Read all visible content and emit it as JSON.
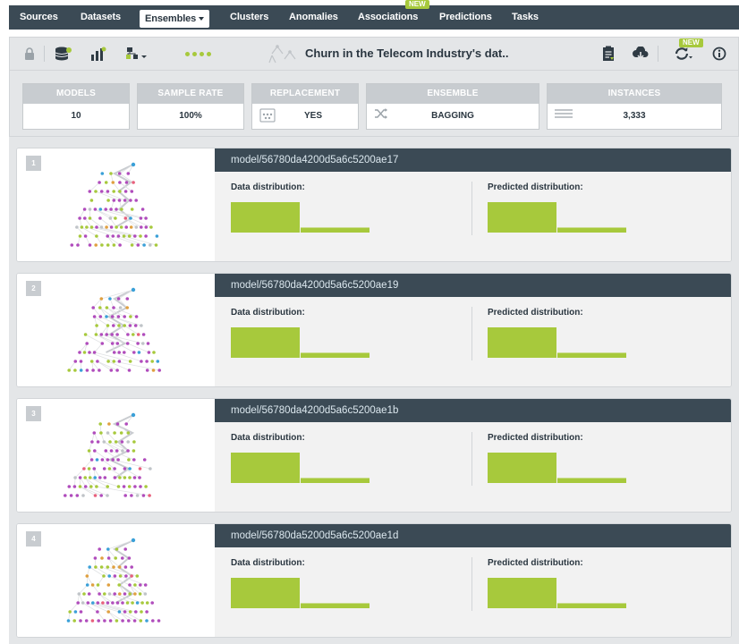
{
  "nav": {
    "items": [
      "Sources",
      "Datasets",
      "Ensembles",
      "Clusters",
      "Anomalies",
      "Associations",
      "Predictions",
      "Tasks"
    ],
    "active": "Ensembles",
    "new_badge": "NEW"
  },
  "toolbar": {
    "title": "Churn in the Telecom Industry's dat..",
    "new_badge": "NEW",
    "icons": [
      "lock-icon",
      "dataset-icon",
      "chart-icon",
      "tree-icon",
      "dots-icon",
      "ensemble-icon",
      "report-icon",
      "cloud-download-icon",
      "batch-icon",
      "info-icon"
    ]
  },
  "summary": {
    "cards": [
      {
        "label": "MODELS",
        "value": "10"
      },
      {
        "label": "SAMPLE RATE",
        "value": "100%"
      },
      {
        "label": "REPLACEMENT",
        "value": "YES"
      },
      {
        "label": "ENSEMBLE",
        "value": "BAGGING"
      },
      {
        "label": "INSTANCES",
        "value": "3,333"
      }
    ]
  },
  "models": [
    {
      "number": "1",
      "id": "model/56780da4200d5a6c5200ae17",
      "data_label": "Data distribution:",
      "pred_label": "Predicted distribution:",
      "data_dist": [
        0.86,
        0.14
      ],
      "pred_dist": [
        0.86,
        0.14
      ]
    },
    {
      "number": "2",
      "id": "model/56780da4200d5a6c5200ae19",
      "data_label": "Data distribution:",
      "pred_label": "Predicted distribution:",
      "data_dist": [
        0.86,
        0.14
      ],
      "pred_dist": [
        0.86,
        0.14
      ]
    },
    {
      "number": "3",
      "id": "model/56780da4200d5a6c5200ae1b",
      "data_label": "Data distribution:",
      "pred_label": "Predicted distribution:",
      "data_dist": [
        0.86,
        0.14
      ],
      "pred_dist": [
        0.86,
        0.14
      ]
    },
    {
      "number": "4",
      "id": "model/56780da5200d5a6c5200ae1d",
      "data_label": "Data distribution:",
      "pred_label": "Predicted distribution:",
      "data_dist": [
        0.86,
        0.14
      ],
      "pred_dist": [
        0.86,
        0.14
      ]
    }
  ],
  "colors": {
    "nav_bg": "#3b4a55",
    "accent": "#a7c93c",
    "panel_bg": "#e4e6e8",
    "tree_colors": [
      "#b04cbc",
      "#a7c93c",
      "#3aa0d8",
      "#e8607c",
      "#e0a040",
      "#c0c4c8"
    ]
  }
}
